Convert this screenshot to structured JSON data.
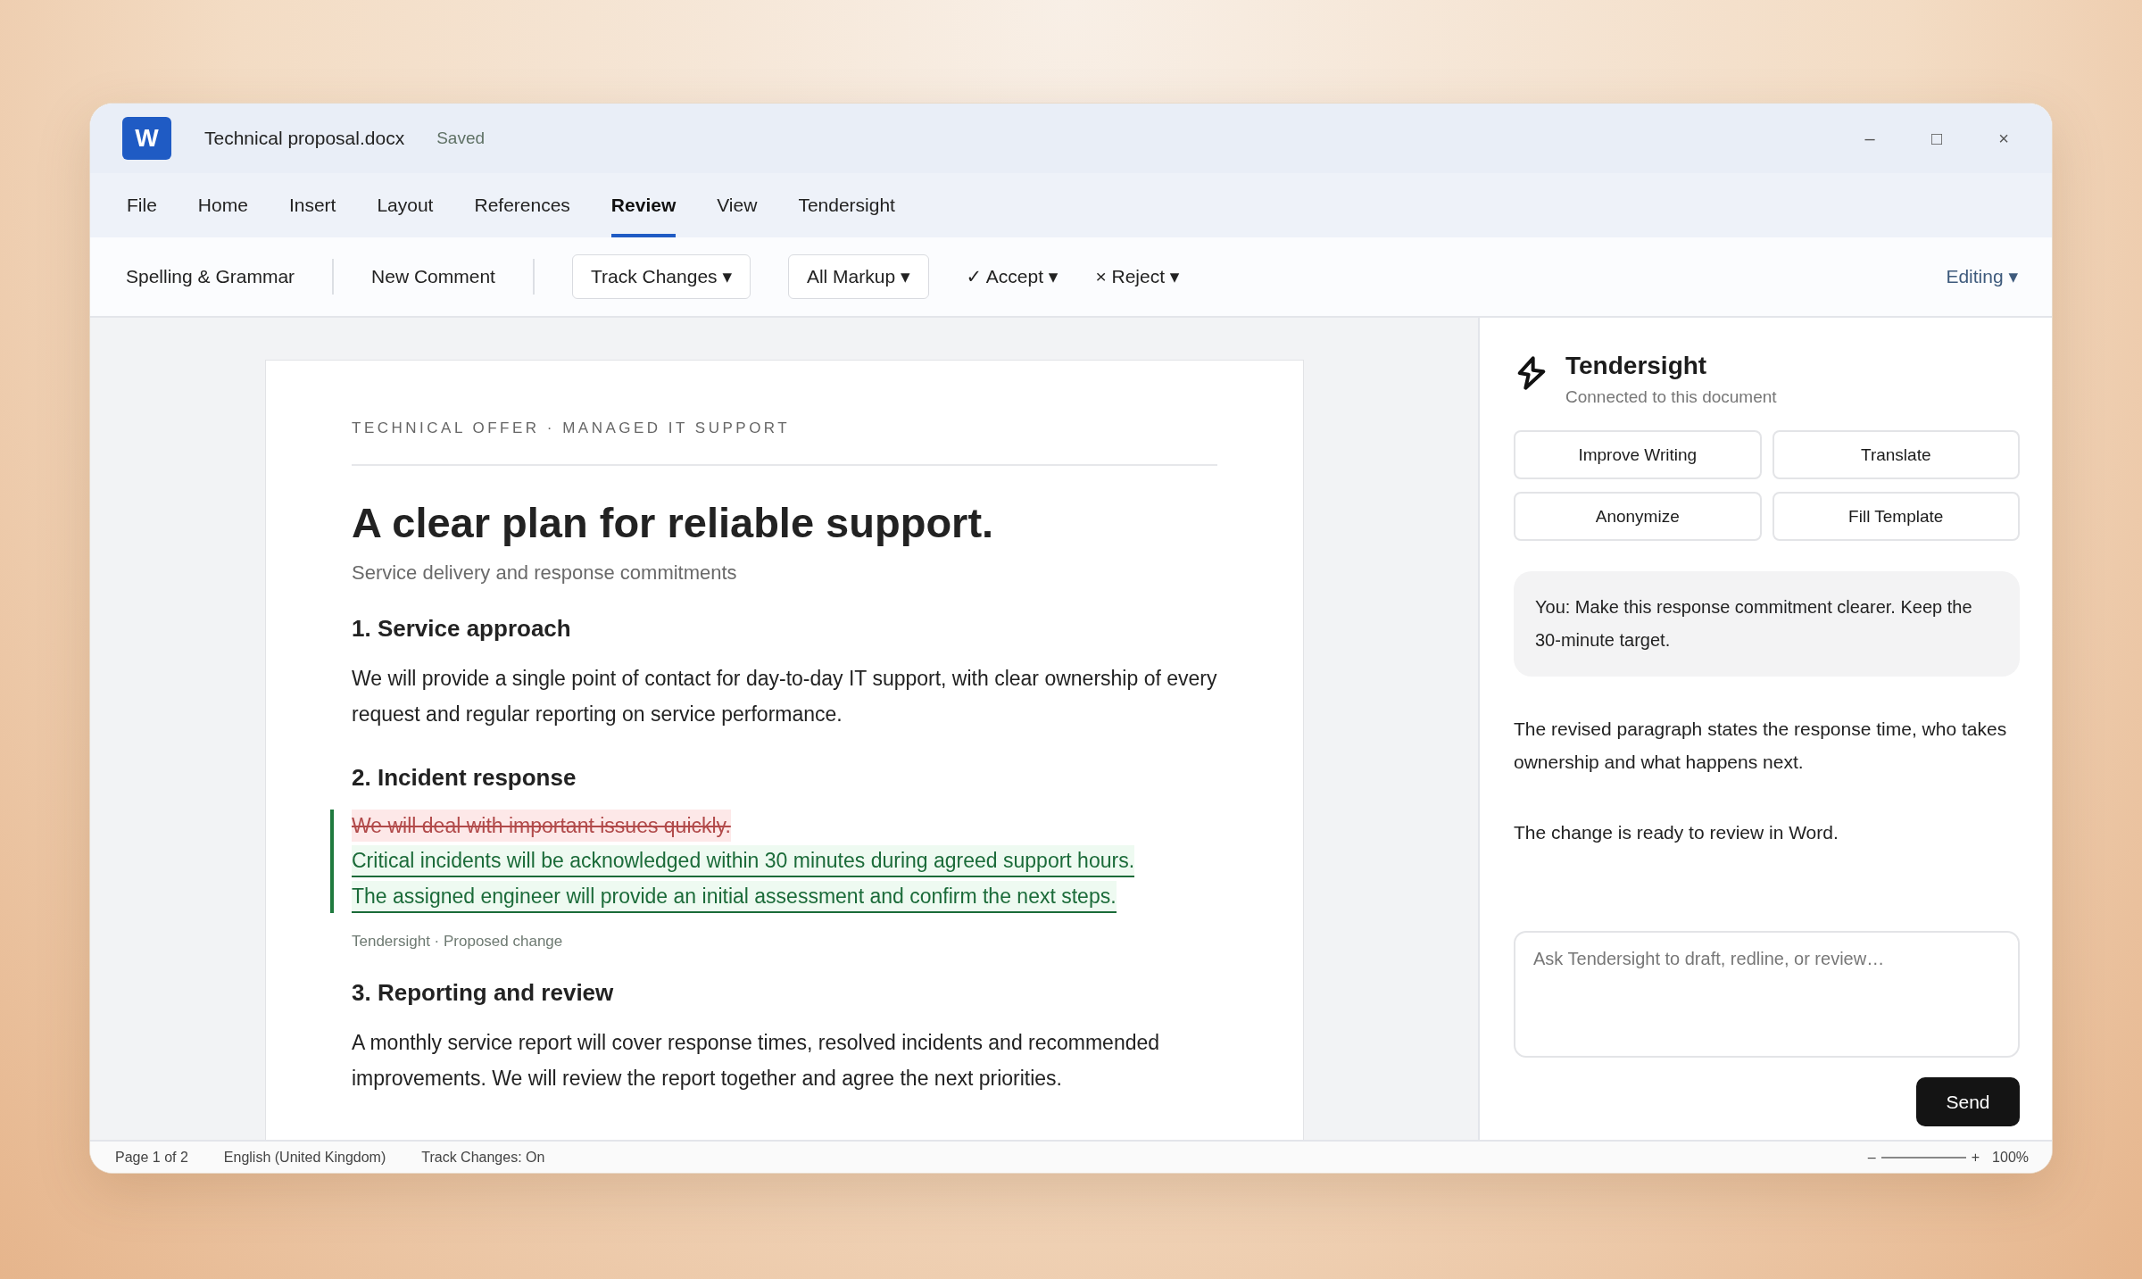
{
  "window": {
    "app_letter": "W",
    "title": "Technical proposal.docx",
    "save_status": "Saved",
    "controls": [
      "–",
      "□",
      "×"
    ]
  },
  "tabs": [
    {
      "label": "File",
      "selected": false
    },
    {
      "label": "Home",
      "selected": false
    },
    {
      "label": "Insert",
      "selected": false
    },
    {
      "label": "Layout",
      "selected": false
    },
    {
      "label": "References",
      "selected": false
    },
    {
      "label": "Review",
      "selected": true
    },
    {
      "label": "View",
      "selected": false
    },
    {
      "label": "Tendersight",
      "selected": false
    }
  ],
  "toolbar": {
    "items": [
      {
        "kind": "text",
        "label": "Spelling & Grammar"
      },
      {
        "kind": "divider"
      },
      {
        "kind": "text",
        "label": "New Comment"
      },
      {
        "kind": "divider"
      },
      {
        "kind": "dropdown",
        "label": "Track Changes ▾"
      },
      {
        "kind": "dropdown",
        "label": "All Markup ▾"
      },
      {
        "kind": "text",
        "label": "✓ Accept ▾"
      },
      {
        "kind": "text",
        "label": "× Reject ▾"
      }
    ],
    "mode": "Editing ▾"
  },
  "document": {
    "eyebrow": "TECHNICAL OFFER · MANAGED IT SUPPORT",
    "title": "A clear plan for reliable support.",
    "subtitle": "Service delivery and response commitments",
    "sections": [
      {
        "heading": "1. Service approach",
        "body": "We will provide a single point of contact for day-to-day IT support, with clear ownership of every request and regular reporting on service performance."
      },
      {
        "heading": "2. Incident response",
        "change": {
          "deleted": "We will deal with important issues quickly.",
          "inserted": [
            "Critical incidents will be acknowledged within 30 minutes during agreed support hours.",
            "The assigned engineer will provide an initial assessment and confirm the next steps."
          ],
          "note": "Tendersight · Proposed change"
        }
      },
      {
        "heading": "3. Reporting and review",
        "body": "A monthly service report will cover response times, resolved incidents and recommended improvements. We will review the report together and agree the next priorities."
      }
    ]
  },
  "assistant": {
    "name": "Tendersight",
    "status": "Connected to this document",
    "actions": [
      "Improve Writing",
      "Translate",
      "Anonymize",
      "Fill Template"
    ],
    "messages": [
      {
        "kind": "user",
        "text": "You: Make this response commitment clearer. Keep the 30-minute target."
      },
      {
        "kind": "assistant",
        "text": "The revised paragraph states the response time, who takes ownership and what happens next."
      },
      {
        "kind": "assistant",
        "text": "The change is ready to review in Word."
      }
    ],
    "input": {
      "placeholder": "Ask Tendersight to draft, redline, or review…"
    },
    "send": "Send"
  },
  "status_bar": {
    "items": [
      "Page 1 of 2",
      "English (United Kingdom)",
      "Track Changes: On"
    ],
    "zoom_minus": "–",
    "zoom_plus": "+",
    "zoom": "100%"
  }
}
